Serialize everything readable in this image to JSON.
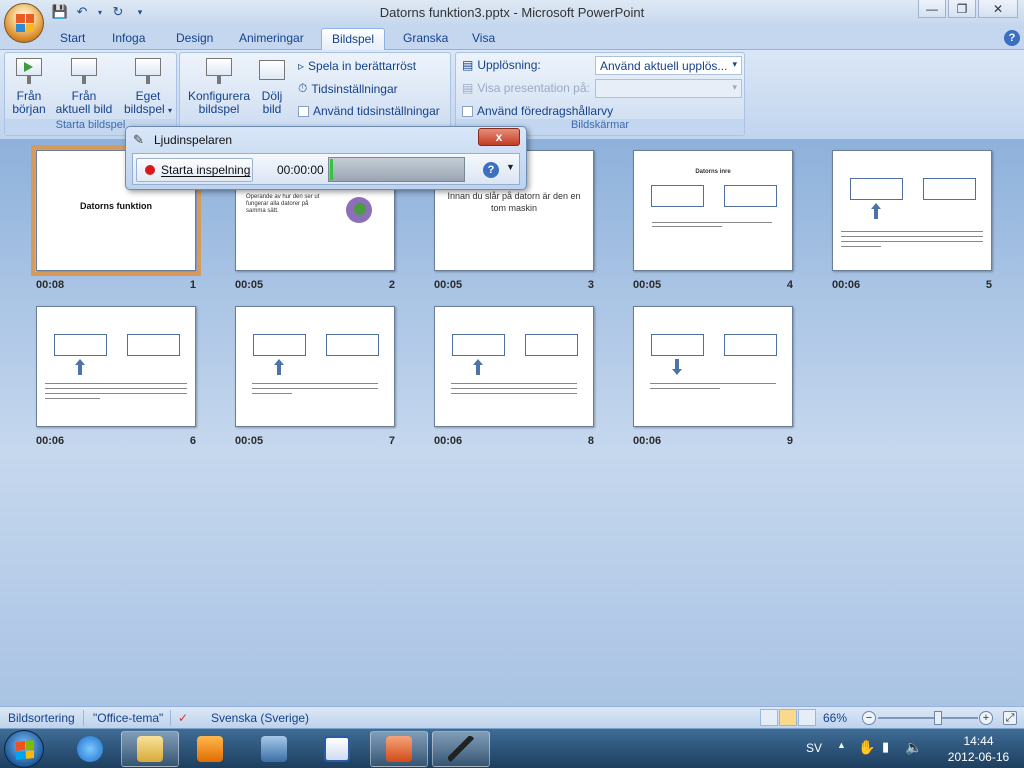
{
  "window": {
    "title": "Datorns funktion3.pptx - Microsoft PowerPoint",
    "controls": [
      "minimize",
      "restore",
      "close"
    ]
  },
  "ribbon_tabs": [
    "Start",
    "Infoga",
    "Design",
    "Animeringar",
    "Bildspel",
    "Granska",
    "Visa"
  ],
  "active_tab": "Bildspel",
  "ribbon": {
    "start_group_label": "Starta bildspel",
    "from_start": "Från\nbörjan",
    "from_start_l1": "Från",
    "from_start_l2": "början",
    "from_current_l1": "Från",
    "from_current_l2": "aktuell bild",
    "custom_l1": "Eget",
    "custom_l2": "bildspel",
    "setup_group_label": "Konfigurera",
    "configure_l1": "Konfigurera",
    "configure_l2": "bildspel",
    "hide_l1": "Dölj",
    "hide_l2": "bild",
    "record_narration": "Spela in berättarröst",
    "rehearse_timings": "Tidsinställningar",
    "use_timings": "Använd tidsinställningar",
    "monitors_group_label": "Bildskärmar",
    "resolution_label": "Upplösning:",
    "resolution_value": "Använd aktuell upplös...",
    "show_on_label": "Visa presentation på:",
    "show_on_value": "",
    "presenter_view": "Använd föredragshållarvy"
  },
  "dialog": {
    "title": "Ljudinspelaren",
    "record_button": "Starta inspelning",
    "time": "00:00:00",
    "close": "x"
  },
  "slides": [
    {
      "num": "1",
      "time": "00:08",
      "title": "Datorns funktion"
    },
    {
      "num": "2",
      "time": "00:05",
      "text1": "Operande av hur den ser ut",
      "text2": "fungerar alla datorer på",
      "text3": "samma sätt."
    },
    {
      "num": "3",
      "time": "00:05",
      "text1": "Innan du slår på datorn är den en",
      "text2": "tom maskin"
    },
    {
      "num": "4",
      "time": "00:05",
      "title": "Datorns inre"
    },
    {
      "num": "5",
      "time": "00:06"
    },
    {
      "num": "6",
      "time": "00:06"
    },
    {
      "num": "7",
      "time": "00:05"
    },
    {
      "num": "8",
      "time": "00:06"
    },
    {
      "num": "9",
      "time": "00:06"
    }
  ],
  "statusbar": {
    "view": "Bildsortering",
    "theme": "\"Office-tema\"",
    "language": "Svenska (Sverige)",
    "zoom": "66%"
  },
  "taskbar": {
    "lang": "SV",
    "time": "14:44",
    "date": "2012-06-16"
  },
  "colors": {
    "accent": "#15428b",
    "selection": "#d69b5c",
    "record": "#d8191b"
  }
}
